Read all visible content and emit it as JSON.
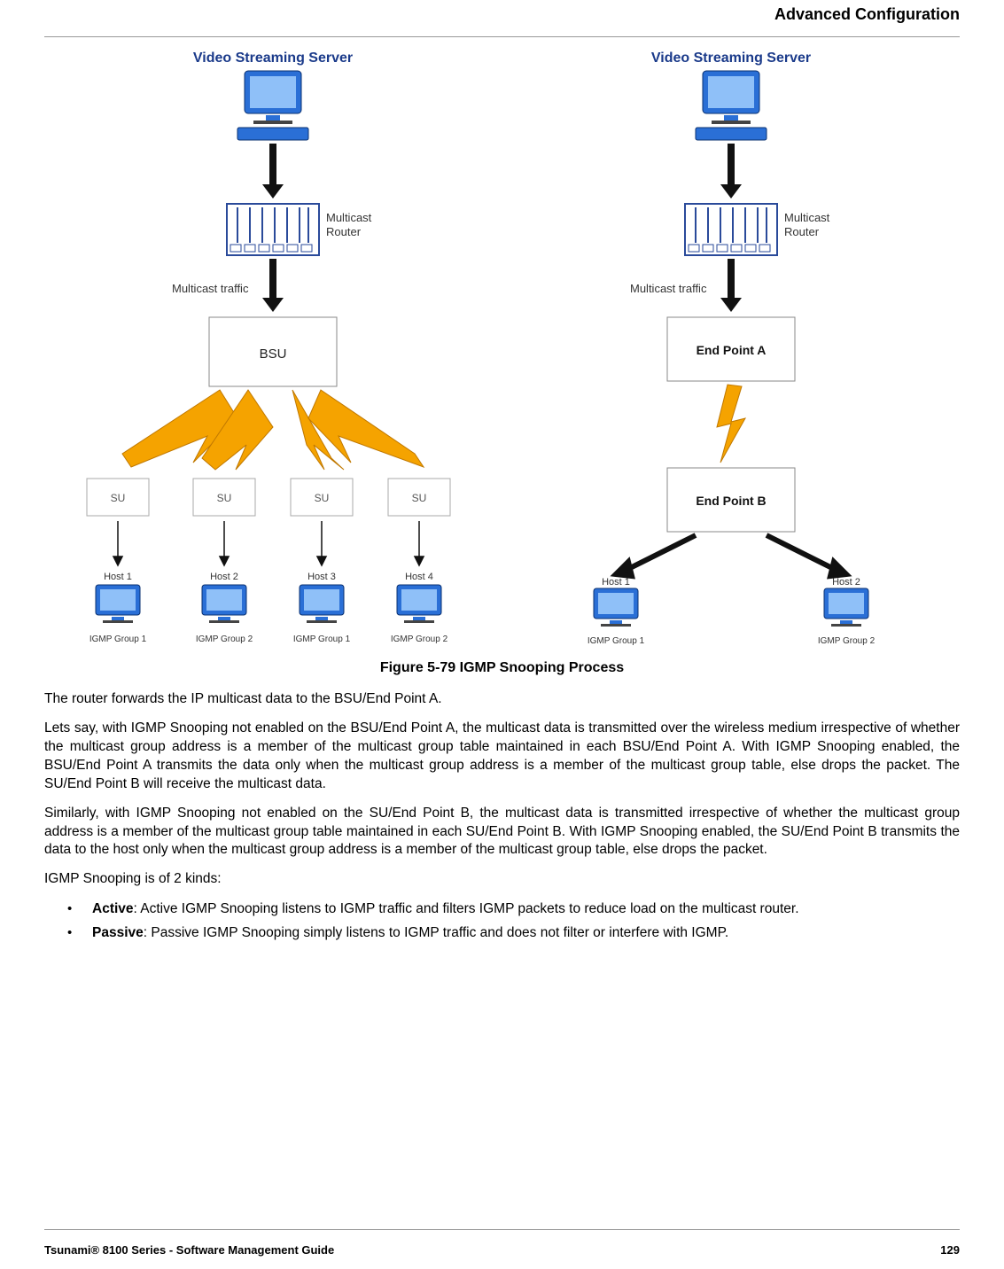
{
  "header": {
    "title": "Advanced Configuration"
  },
  "figure": {
    "caption": "Figure 5-79 IGMP Snooping Process",
    "left": {
      "server": "Video Streaming Server",
      "router": "Multicast\nRouter",
      "traffic": "Multicast traffic",
      "center": "BSU",
      "units": [
        "SU",
        "SU",
        "SU",
        "SU"
      ],
      "hosts": [
        "Host 1",
        "Host 2",
        "Host 3",
        "Host 4"
      ],
      "groups": [
        "IGMP Group 1",
        "IGMP Group 2",
        "IGMP Group 1",
        "IGMP Group 2"
      ]
    },
    "right": {
      "server": "Video Streaming Server",
      "router": "Multicast\nRouter",
      "traffic": "Multicast traffic",
      "epa": "End Point A",
      "epb": "End Point B",
      "hosts": [
        "Host 1",
        "Host 2"
      ],
      "groups": [
        "IGMP Group 1",
        "IGMP Group 2"
      ]
    }
  },
  "paragraphs": {
    "p1": "The router forwards the IP multicast data to the BSU/End Point A.",
    "p2": "Lets say, with IGMP Snooping not enabled on the BSU/End Point A, the multicast data is transmitted over the wireless medium irrespective of whether the multicast group address is a member of the multicast group table maintained in each BSU/End Point A. With IGMP Snooping enabled, the BSU/End Point A transmits the data only when the multicast group address is a member of the multicast group table, else drops the packet. The SU/End Point B will receive the multicast data.",
    "p3": "Similarly, with IGMP Snooping not enabled on the SU/End Point B, the multicast data is transmitted irrespective of whether the multicast group address is a member of the multicast group table maintained in each SU/End Point B. With IGMP Snooping enabled, the SU/End Point B transmits the data to the host only when the multicast group address is a member of the multicast group table, else drops the packet.",
    "p4": "IGMP Snooping is of 2 kinds:"
  },
  "kinds": {
    "active_label": "Active",
    "active_text": ": Active IGMP Snooping listens to IGMP traffic and filters IGMP packets to reduce load on the multicast router.",
    "passive_label": "Passive",
    "passive_text": ": Passive IGMP Snooping simply listens to IGMP traffic and does not filter or interfere with IGMP."
  },
  "footer": {
    "left": "Tsunami® 8100 Series - Software Management Guide",
    "right": "129"
  }
}
